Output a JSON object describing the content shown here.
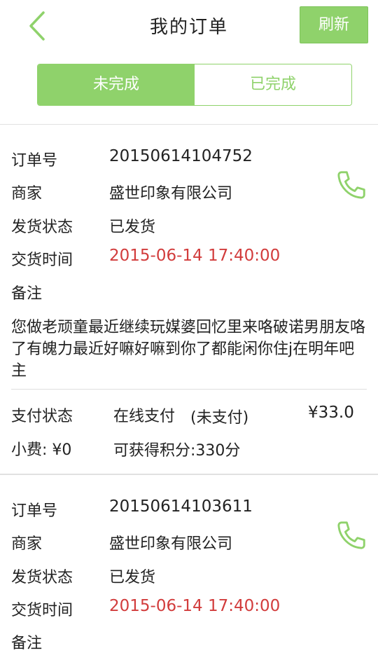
{
  "header": {
    "title": "我的订单",
    "refresh_label": "刷新"
  },
  "tabs": [
    {
      "label": "未完成",
      "active": true
    },
    {
      "label": "已完成",
      "active": false
    }
  ],
  "labels": {
    "order_no": "订单号",
    "merchant": "商家",
    "ship_status": "发货状态",
    "delivery_time": "交货时间",
    "note": "备注",
    "pay_status": "支付状态",
    "tip": "小费: ¥0"
  },
  "orders": [
    {
      "order_no": "20150614104752",
      "merchant": "盛世印象有限公司",
      "ship_status": "已发货",
      "delivery_time": "2015-06-14 17:40:00",
      "note": "您做老顽童最近继续玩媒婆回忆里来咯破诺男朋友咯了有魄力最近好嘛好嘛到你了都能闲你住j在明年吧主",
      "pay_method": "在线支付",
      "pay_state": "(未支付)",
      "amount": "¥33.0",
      "points": "可获得积分:330分"
    },
    {
      "order_no": "20150614103611",
      "merchant": "盛世印象有限公司",
      "ship_status": "已发货",
      "delivery_time": "2015-06-14 17:40:00"
    }
  ],
  "colors": {
    "accent": "#8fd26b",
    "highlight": "#d23c3c"
  },
  "icons": {
    "back": "chevron-left-icon",
    "phone": "phone-icon"
  }
}
